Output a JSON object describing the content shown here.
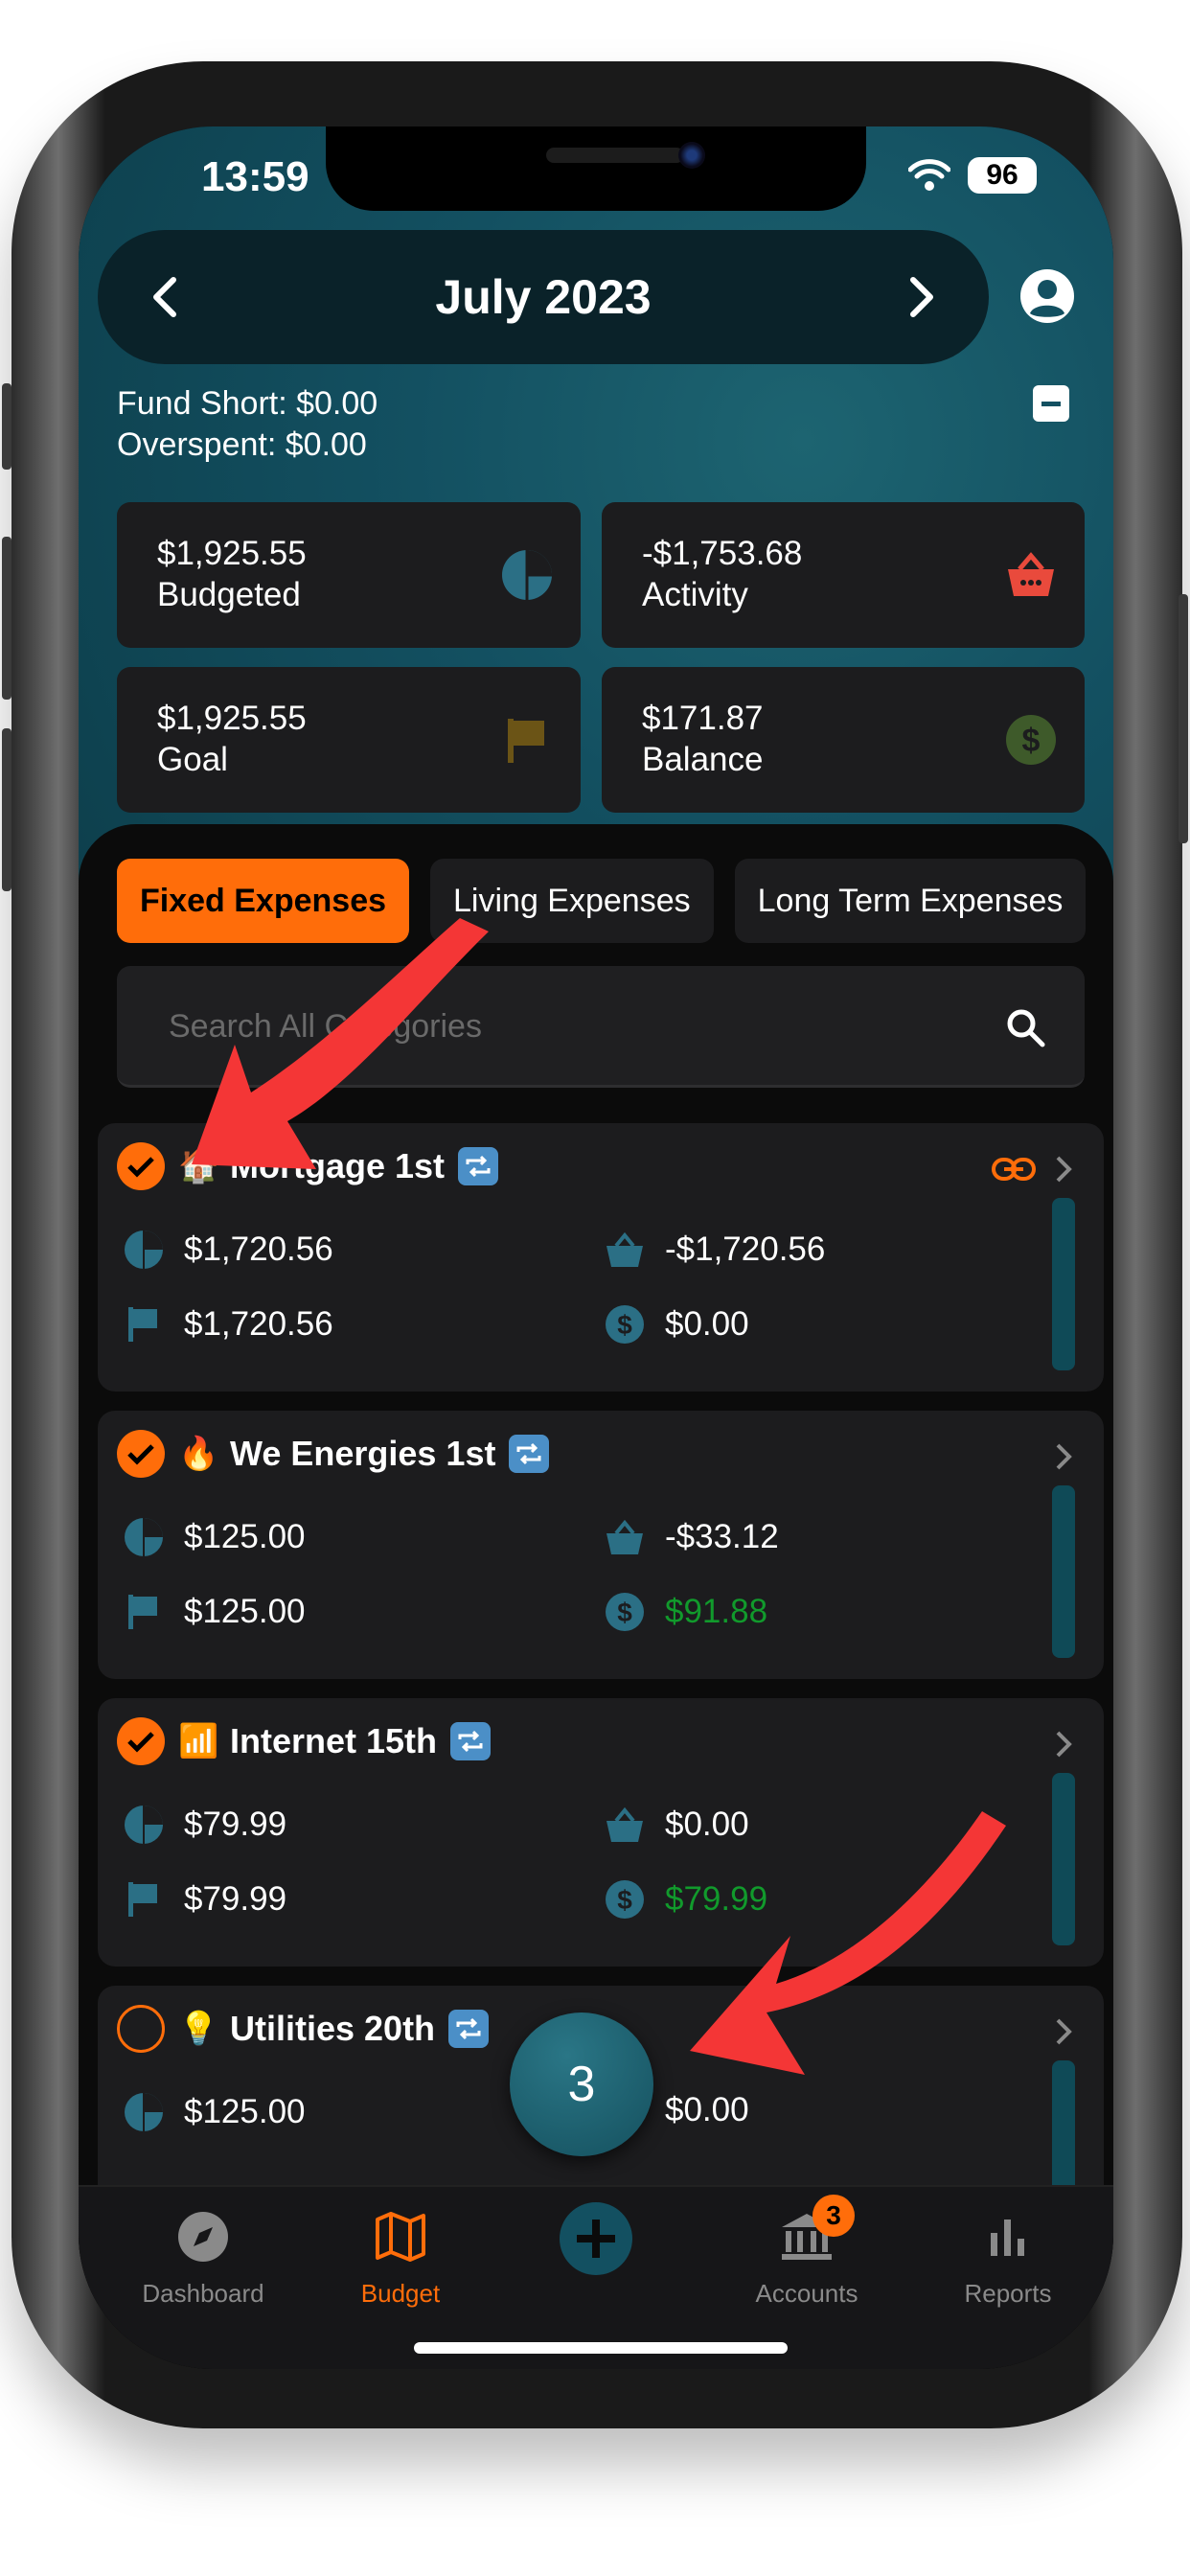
{
  "status_bar": {
    "time": "13:59",
    "battery": "96"
  },
  "header": {
    "month": "July 2023"
  },
  "fund_info": {
    "fund_short": "Fund Short: $0.00",
    "overspent": "Overspent: $0.00"
  },
  "summary": {
    "budgeted": {
      "value": "$1,925.55",
      "label": "Budgeted"
    },
    "activity": {
      "value": "-$1,753.68",
      "label": "Activity"
    },
    "goal": {
      "value": "$1,925.55",
      "label": "Goal"
    },
    "balance": {
      "value": "$171.87",
      "label": "Balance"
    }
  },
  "tabs": [
    "Fixed Expenses",
    "Living Expenses",
    "Long Term Expenses"
  ],
  "search": {
    "placeholder": "Search All Categories"
  },
  "categories": [
    {
      "emoji": "🏠",
      "name": "Mortgage 1st",
      "checked": true,
      "budgeted": "$1,720.56",
      "activity": "-$1,720.56",
      "goal": "$1,720.56",
      "balance": "$0.00"
    },
    {
      "emoji": "🔥",
      "name": "We Energies 1st",
      "checked": true,
      "budgeted": "$125.00",
      "activity": "-$33.12",
      "goal": "$125.00",
      "balance": "$91.88"
    },
    {
      "emoji": "📶",
      "name": "Internet 15th",
      "checked": true,
      "budgeted": "$79.99",
      "activity": "$0.00",
      "goal": "$79.99",
      "balance": "$79.99"
    },
    {
      "emoji": "💡",
      "name": "Utilities 20th",
      "checked": false,
      "budgeted": "$125.00",
      "activity": "$0.00"
    }
  ],
  "fab": {
    "count": "3"
  },
  "tabbar": {
    "dashboard": "Dashboard",
    "budget": "Budget",
    "accounts": "Accounts",
    "accounts_badge": "3",
    "reports": "Reports"
  },
  "colors": {
    "accent": "#ff6d0a",
    "teal": "#135061",
    "positive": "#119a2c",
    "arrow": "#f43636"
  }
}
